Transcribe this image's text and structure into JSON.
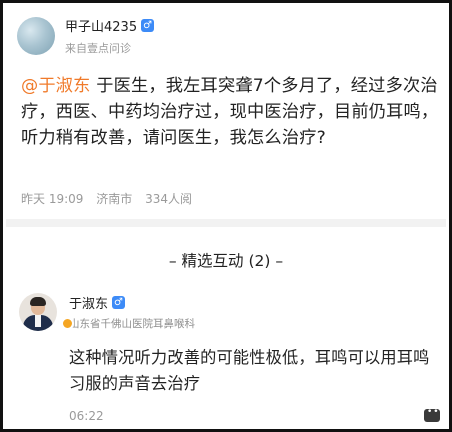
{
  "post": {
    "username": "甲子山4235",
    "gender_badge": "♂",
    "source": "来自壹点问诊",
    "mention": "@于淑东",
    "question": " 于医生，我左耳突聋7个多月了，经过多次治疗，西医、中药均治疗过，现中医治疗，目前仍耳鸣，听力稍有改善，请问医生，我怎么治疗?",
    "time": "昨天 19:09",
    "location": "济南市",
    "views": "334人阅"
  },
  "interaction": {
    "title": "– 精选互动 (2) –"
  },
  "reply": {
    "doctor_name": "于淑东",
    "gender_badge": "♂",
    "hospital": "山东省千佛山医院耳鼻喉科",
    "answer": "这种情况听力改善的可能性极低，耳鸣可以用耳鸣习服的声音去治疗",
    "time": "06:22",
    "icons": {
      "comment": "comment-icon"
    }
  },
  "colors": {
    "mention": "#f07a2a",
    "badge_blue": "#3d8bf7",
    "verify": "#f5a623",
    "muted": "#9a9a9a"
  }
}
